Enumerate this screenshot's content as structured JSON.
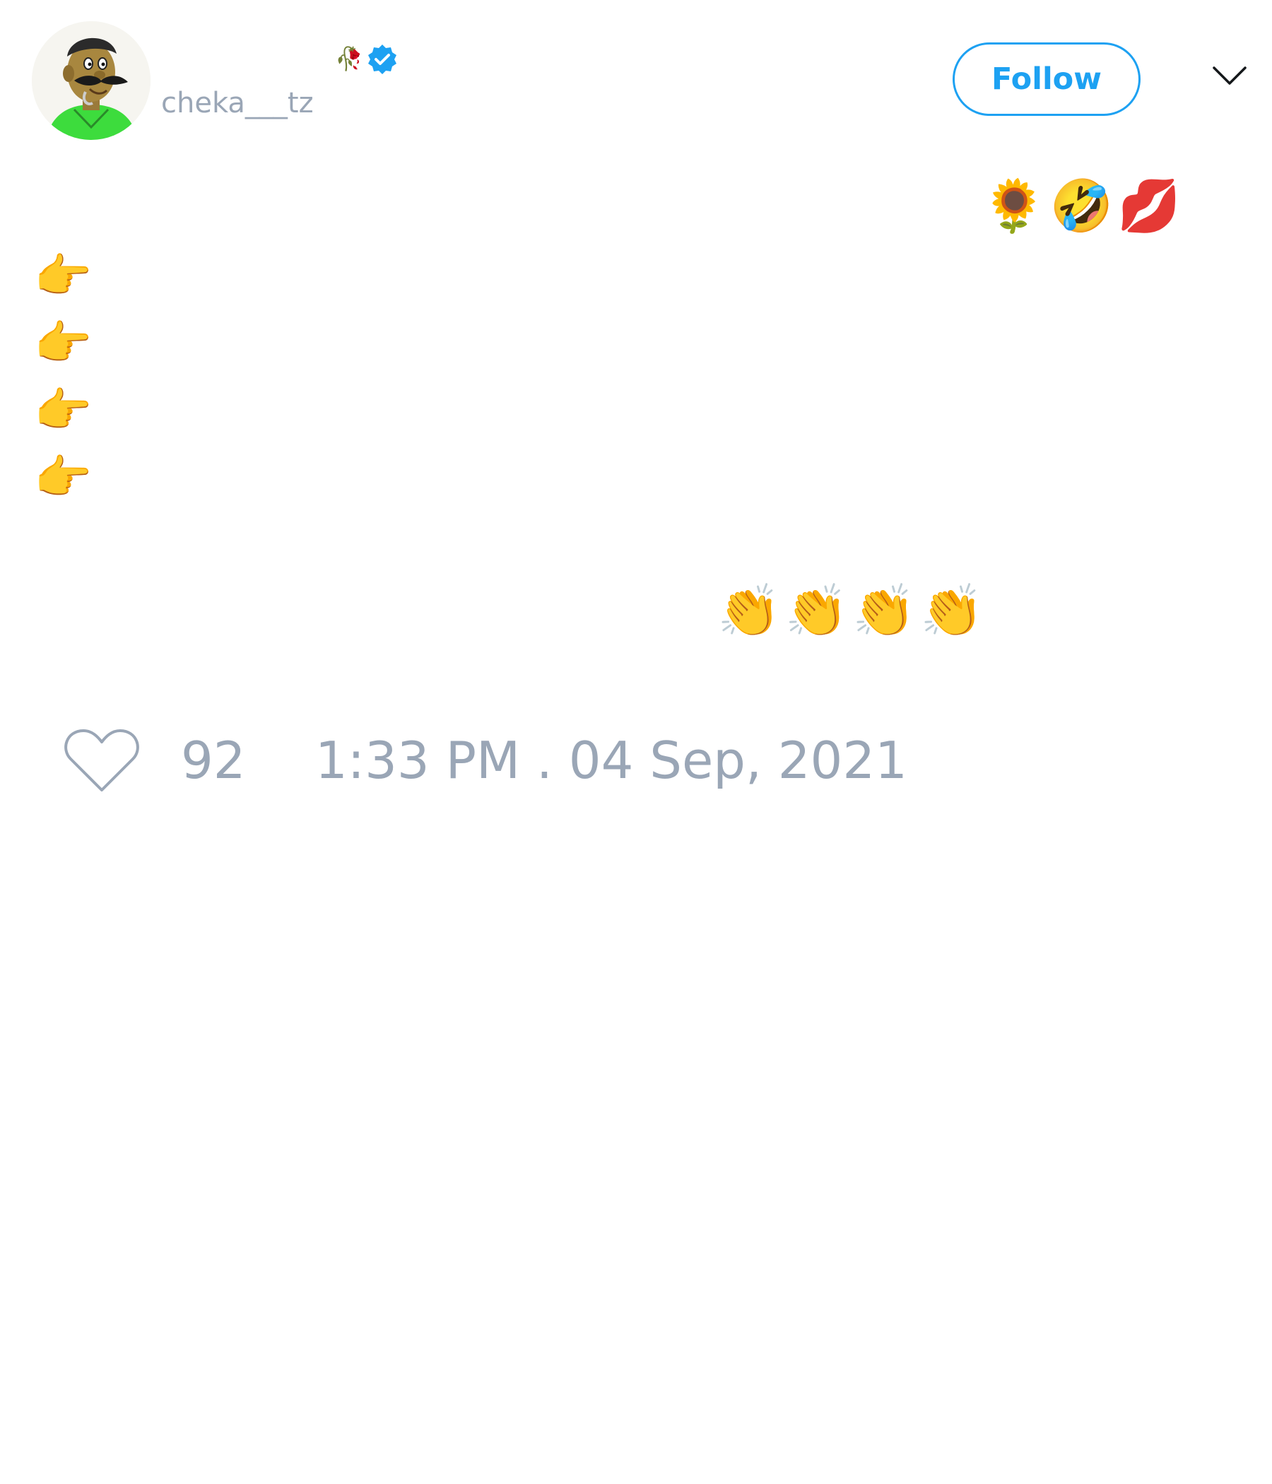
{
  "author": {
    "handle": "cheka___tz",
    "name_emoji": "🥀",
    "verified": true,
    "avatar_icon": "cartoon-man-with-mustache-icon"
  },
  "follow_button": {
    "label": "Follow",
    "color": "#1da1f2"
  },
  "menu_icon": "chevron-down-icon",
  "tweet": {
    "emoji_line_top": "🌻🤣💋",
    "pointers": [
      "👉",
      "👉",
      "👉",
      "👉"
    ],
    "emoji_line_clap": "👏👏👏👏"
  },
  "footer": {
    "heart_icon": "heart-outline-icon",
    "like_count": "92",
    "timestamp": "1:33 PM . 04 Sep, 2021"
  },
  "colors": {
    "muted_text": "#9aa6b6",
    "accent": "#1da1f2"
  }
}
